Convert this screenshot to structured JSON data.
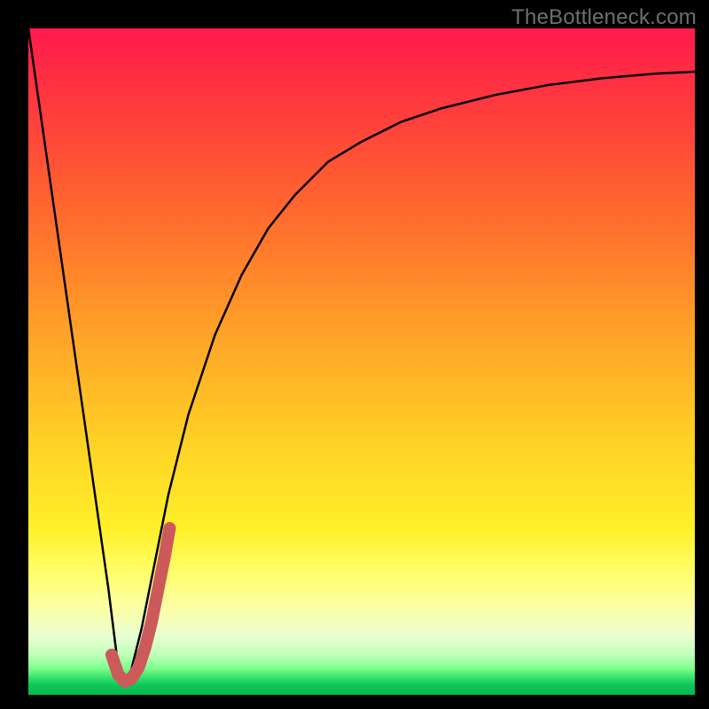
{
  "watermark": {
    "text": "TheBottleneck.com"
  },
  "chart_data": {
    "type": "line",
    "title": "",
    "xlabel": "",
    "ylabel": "",
    "xlim": [
      0,
      100
    ],
    "ylim": [
      0,
      100
    ],
    "grid": false,
    "legend": false,
    "series": [
      {
        "name": "bottleneck-curve",
        "color": "#000000",
        "x": [
          0,
          2,
          4,
          6,
          8,
          10,
          12,
          13.5,
          15,
          17,
          19,
          21,
          24,
          28,
          32,
          36,
          40,
          45,
          50,
          56,
          62,
          70,
          78,
          86,
          94,
          100
        ],
        "y": [
          100,
          86,
          72,
          58,
          44,
          30,
          16,
          4,
          2,
          10,
          20,
          30,
          42,
          54,
          63,
          70,
          75,
          80,
          83,
          86,
          88,
          90,
          91.5,
          92.5,
          93.2,
          93.5
        ]
      },
      {
        "name": "highlight-hook",
        "color": "#cc5a5a",
        "x": [
          12.5,
          13.5,
          14.5,
          15.5,
          16.5,
          17.5,
          18.5,
          19.5,
          20.5,
          21.2
        ],
        "y": [
          6,
          3,
          2,
          2.5,
          4,
          7,
          11,
          16,
          21,
          25
        ]
      }
    ],
    "background_gradient": {
      "direction": "top-to-bottom",
      "stops": [
        {
          "pos": 0.0,
          "color": "#ff1a4d"
        },
        {
          "pos": 0.28,
          "color": "#ff6a2e"
        },
        {
          "pos": 0.62,
          "color": "#ffd126"
        },
        {
          "pos": 0.82,
          "color": "#ffff6e"
        },
        {
          "pos": 0.94,
          "color": "#bfffba"
        },
        {
          "pos": 1.0,
          "color": "#05b94f"
        }
      ]
    }
  }
}
